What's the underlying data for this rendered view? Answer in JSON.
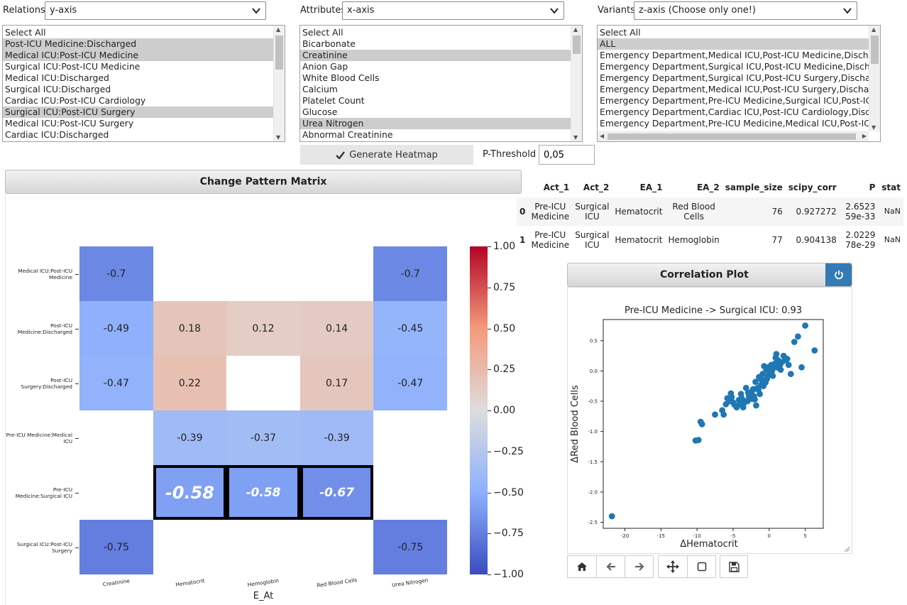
{
  "filters": {
    "relations": {
      "label": "Relations",
      "value": "y-axis",
      "items": [
        {
          "text": "Select All",
          "sel": false
        },
        {
          "text": "Post-ICU Medicine:Discharged",
          "sel": true
        },
        {
          "text": "Medical ICU:Post-ICU Medicine",
          "sel": true
        },
        {
          "text": "Surgical ICU:Post-ICU Medicine",
          "sel": false
        },
        {
          "text": "Medical ICU:Discharged",
          "sel": false
        },
        {
          "text": "Surgical ICU:Discharged",
          "sel": false
        },
        {
          "text": "Cardiac ICU:Post-ICU Cardiology",
          "sel": false
        },
        {
          "text": "Surgical ICU:Post-ICU Surgery",
          "sel": true
        },
        {
          "text": "Medical ICU:Post-ICU Surgery",
          "sel": false
        },
        {
          "text": "Cardiac ICU:Discharged",
          "sel": false
        }
      ]
    },
    "attributes": {
      "label": "Attributes",
      "value": "x-axis",
      "items": [
        {
          "text": "Select All",
          "sel": false
        },
        {
          "text": "Bicarbonate",
          "sel": false
        },
        {
          "text": "Creatinine",
          "sel": true
        },
        {
          "text": "Anion Gap",
          "sel": false
        },
        {
          "text": "White Blood Cells",
          "sel": false
        },
        {
          "text": "Calcium",
          "sel": false
        },
        {
          "text": "Platelet Count",
          "sel": false
        },
        {
          "text": "Glucose",
          "sel": false
        },
        {
          "text": "Urea Nitrogen",
          "sel": true
        },
        {
          "text": "Abnormal Creatinine",
          "sel": false
        }
      ]
    },
    "variants": {
      "label": "Variants",
      "value": "z-axis (Choose only one!)",
      "items": [
        {
          "text": "Select All",
          "sel": false
        },
        {
          "text": "ALL",
          "sel": true
        },
        {
          "text": "Emergency Department,Medical ICU,Post-ICU Medicine,Discharged",
          "sel": false
        },
        {
          "text": "Emergency Department,Surgical ICU,Post-ICU Medicine,Discharged",
          "sel": false
        },
        {
          "text": "Emergency Department,Surgical ICU,Post-ICU Surgery,Discharged",
          "sel": false
        },
        {
          "text": "Emergency Department,Medical ICU,Post-ICU Surgery,Discharged",
          "sel": false
        },
        {
          "text": "Emergency Department,Pre-ICU Medicine,Surgical ICU,Post-ICU Medicine",
          "sel": false
        },
        {
          "text": "Emergency Department,Cardiac ICU,Post-ICU Cardiology,Discharged",
          "sel": false
        },
        {
          "text": "Emergency Department,Pre-ICU Medicine,Medical ICU,Post-ICU Medicine",
          "sel": false
        }
      ]
    }
  },
  "generate_label": "Generate Heatmap",
  "pthreshold": {
    "label": "P-Threshold",
    "value": "0,05"
  },
  "matrix_panel": {
    "title": "Change Pattern Matrix"
  },
  "chart_data": [
    {
      "type": "heatmap",
      "title": "Change Pattern Matrix",
      "xlabel": "E_At",
      "x": [
        "Creatinine",
        "Hematocrit",
        "Hemoglobin",
        "Red Blood Cells",
        "Urea Nitrogen"
      ],
      "y": [
        "Medical ICU:Post-ICU Medicine",
        "Post-ICU Medicine:Discharged",
        "Post-ICU Surgery:Discharged",
        "Pre-ICU Medicine:Medical ICU",
        "Pre-ICU Medicine:Surgical ICU",
        "Surgical ICU:Post-ICU Surgery"
      ],
      "values": [
        [
          -0.7,
          null,
          null,
          null,
          -0.7
        ],
        [
          -0.49,
          0.18,
          0.12,
          0.14,
          -0.45
        ],
        [
          -0.47,
          0.22,
          null,
          0.17,
          -0.47
        ],
        [
          null,
          -0.39,
          -0.37,
          -0.39,
          null
        ],
        [
          null,
          -0.58,
          -0.58,
          -0.67,
          null
        ],
        [
          -0.75,
          null,
          null,
          null,
          -0.75
        ]
      ],
      "highlighted": [
        [
          4,
          1
        ],
        [
          4,
          2
        ],
        [
          4,
          3
        ]
      ],
      "colorbar": {
        "range": [
          -1.0,
          1.0
        ],
        "ticks": [
          "1.00",
          "0.75",
          "0.50",
          "0.25",
          "0.00",
          "−0.25",
          "−0.50",
          "−0.75",
          "−1.00"
        ],
        "colormap": "coolwarm"
      }
    },
    {
      "type": "scatter",
      "title": "Pre-ICU Medicine -> Surgical ICU: 0.93",
      "xlabel": "ΔHematocrit",
      "ylabel": "ΔRed Blood Cells",
      "xlim": [
        -23,
        7.5
      ],
      "ylim": [
        -2.6,
        0.85
      ],
      "xticks": [
        -20,
        -15,
        -10,
        -5,
        0,
        5
      ],
      "yticks": [
        0.5,
        0.0,
        -0.5,
        -1.0,
        -1.5,
        -2.0,
        -2.5
      ],
      "color": "#1f77b4",
      "points": [
        [
          -21.8,
          -2.4
        ],
        [
          -10.2,
          -1.15
        ],
        [
          -9.8,
          -1.14
        ],
        [
          -9.5,
          -0.84
        ],
        [
          -9.3,
          -0.88
        ],
        [
          -7.5,
          -0.72
        ],
        [
          -6.5,
          -0.65
        ],
        [
          -6.3,
          -0.72
        ],
        [
          -6.0,
          -0.55
        ],
        [
          -5.8,
          -0.45
        ],
        [
          -5.5,
          -0.5
        ],
        [
          -5.2,
          -0.43
        ],
        [
          -5.0,
          -0.52
        ],
        [
          -4.8,
          -0.56
        ],
        [
          -4.5,
          -0.6
        ],
        [
          -4.2,
          -0.48
        ],
        [
          -4.0,
          -0.52
        ],
        [
          -3.8,
          -0.45
        ],
        [
          -3.5,
          -0.53
        ],
        [
          -3.3,
          -0.5
        ],
        [
          -3.0,
          -0.5
        ],
        [
          -2.8,
          -0.42
        ],
        [
          -2.5,
          -0.38
        ],
        [
          -2.3,
          -0.32
        ],
        [
          -2.1,
          -0.42
        ],
        [
          -2.0,
          -0.47
        ],
        [
          -1.8,
          -0.57
        ],
        [
          -1.6,
          -0.28
        ],
        [
          -1.5,
          -0.31
        ],
        [
          -1.3,
          -0.38
        ],
        [
          -1.2,
          -0.24
        ],
        [
          -1.0,
          -0.22
        ],
        [
          -0.8,
          -0.25
        ],
        [
          -0.6,
          -0.15
        ],
        [
          -0.5,
          -0.19
        ],
        [
          -0.3,
          -0.13
        ],
        [
          -0.2,
          -0.08
        ],
        [
          0.0,
          -0.02
        ],
        [
          0.2,
          0.08
        ],
        [
          0.4,
          0.0
        ],
        [
          0.6,
          0.05
        ],
        [
          0.8,
          0.12
        ],
        [
          1.0,
          0.28
        ],
        [
          1.2,
          0.18
        ],
        [
          1.5,
          0.1
        ],
        [
          1.8,
          0.15
        ],
        [
          2.0,
          0.25
        ],
        [
          2.3,
          0.18
        ],
        [
          2.7,
          0.1
        ],
        [
          3.0,
          -0.05
        ],
        [
          3.5,
          0.48
        ],
        [
          4.0,
          0.57
        ],
        [
          4.5,
          0.06
        ],
        [
          5.0,
          0.75
        ],
        [
          6.3,
          0.34
        ],
        [
          -4.1,
          -0.55
        ],
        [
          -3.6,
          -0.6
        ],
        [
          -2.7,
          -0.4
        ],
        [
          -2.2,
          -0.3
        ],
        [
          -1.4,
          -0.1
        ],
        [
          -0.9,
          -0.05
        ],
        [
          -0.4,
          0.02
        ],
        [
          0.3,
          0.1
        ],
        [
          0.9,
          0.22
        ],
        [
          1.6,
          0.02
        ],
        [
          -5.3,
          -0.37
        ],
        [
          -3.2,
          -0.28
        ],
        [
          -1.9,
          -0.18
        ],
        [
          -0.7,
          0.08
        ],
        [
          0.5,
          -0.08
        ],
        [
          -2.4,
          -0.46
        ],
        [
          -3.9,
          -0.38
        ],
        [
          2.5,
          0.2
        ],
        [
          1.3,
          0.05
        ],
        [
          -1.1,
          -0.14
        ],
        [
          -2.9,
          -0.36
        ],
        [
          -0.1,
          0.06
        ]
      ]
    }
  ],
  "results_table": {
    "headers": [
      "",
      "Act_1",
      "Act_2",
      "EA_1",
      "EA_2",
      "sample_size",
      "scipy_corr",
      "P",
      "stat"
    ],
    "rows": [
      [
        "0",
        "Pre-ICU Medicine",
        "Surgical ICU",
        "Hematocrit",
        "Red Blood Cells",
        "76",
        "0.927272",
        "2.652359e-33",
        "NaN"
      ],
      [
        "1",
        "Pre-ICU Medicine",
        "Surgical ICU",
        "Hematocrit",
        "Hemoglobin",
        "77",
        "0.904138",
        "2.022978e-29",
        "NaN"
      ]
    ]
  },
  "corr_panel": {
    "title": "Correlation Plot"
  },
  "toolbar": {
    "icons": [
      "home-icon",
      "back-arrow-icon",
      "forward-arrow-icon",
      "pan-move-icon",
      "zoom-rect-icon",
      "save-icon"
    ]
  },
  "colors": {
    "high": "#b40426",
    "mid": "#dddddd",
    "low": "#3b4cc0",
    "scatter": "#1f77b4",
    "power_button": "#337ab7"
  }
}
